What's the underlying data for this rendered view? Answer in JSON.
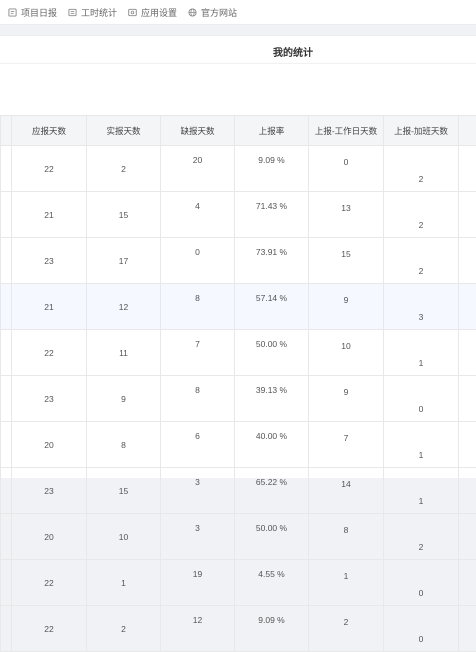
{
  "nav": {
    "items": [
      {
        "label": "项目日报",
        "icon": "report-icon"
      },
      {
        "label": "工时统计",
        "icon": "clock-icon"
      },
      {
        "label": "应用设置",
        "icon": "settings-icon"
      },
      {
        "label": "官方网站",
        "icon": "globe-icon"
      }
    ]
  },
  "stats": {
    "title": "我的统计",
    "columns": [
      "应报天数",
      "实报天数",
      "缺报天数",
      "上报率",
      "上报-工作日天数",
      "上报-加班天数"
    ],
    "rows": [
      {
        "due": "22",
        "actual": "2",
        "missing": "20",
        "rate": "9.09 %",
        "workday": "0",
        "overtime": "2"
      },
      {
        "due": "21",
        "actual": "15",
        "missing": "4",
        "rate": "71.43 %",
        "workday": "13",
        "overtime": "2"
      },
      {
        "due": "23",
        "actual": "17",
        "missing": "0",
        "rate": "73.91 %",
        "workday": "15",
        "overtime": "2"
      },
      {
        "due": "21",
        "actual": "12",
        "missing": "8",
        "rate": "57.14 %",
        "workday": "9",
        "overtime": "3"
      },
      {
        "due": "22",
        "actual": "11",
        "missing": "7",
        "rate": "50.00 %",
        "workday": "10",
        "overtime": "1"
      },
      {
        "due": "23",
        "actual": "9",
        "missing": "8",
        "rate": "39.13 %",
        "workday": "9",
        "overtime": "0"
      },
      {
        "due": "20",
        "actual": "8",
        "missing": "6",
        "rate": "40.00 %",
        "workday": "7",
        "overtime": "1"
      },
      {
        "due": "23",
        "actual": "15",
        "missing": "3",
        "rate": "65.22 %",
        "workday": "14",
        "overtime": "1"
      },
      {
        "due": "20",
        "actual": "10",
        "missing": "3",
        "rate": "50.00 %",
        "workday": "8",
        "overtime": "2"
      },
      {
        "due": "22",
        "actual": "1",
        "missing": "19",
        "rate": "4.55 %",
        "workday": "1",
        "overtime": "0"
      },
      {
        "due": "22",
        "actual": "2",
        "missing": "12",
        "rate": "9.09 %",
        "workday": "2",
        "overtime": "0"
      }
    ]
  },
  "colors": {
    "header_bg": "#f4f5f7",
    "border": "#e8e8e8",
    "highlight_row": "#f5f8ff",
    "page_bg": "#f0f2f5"
  }
}
